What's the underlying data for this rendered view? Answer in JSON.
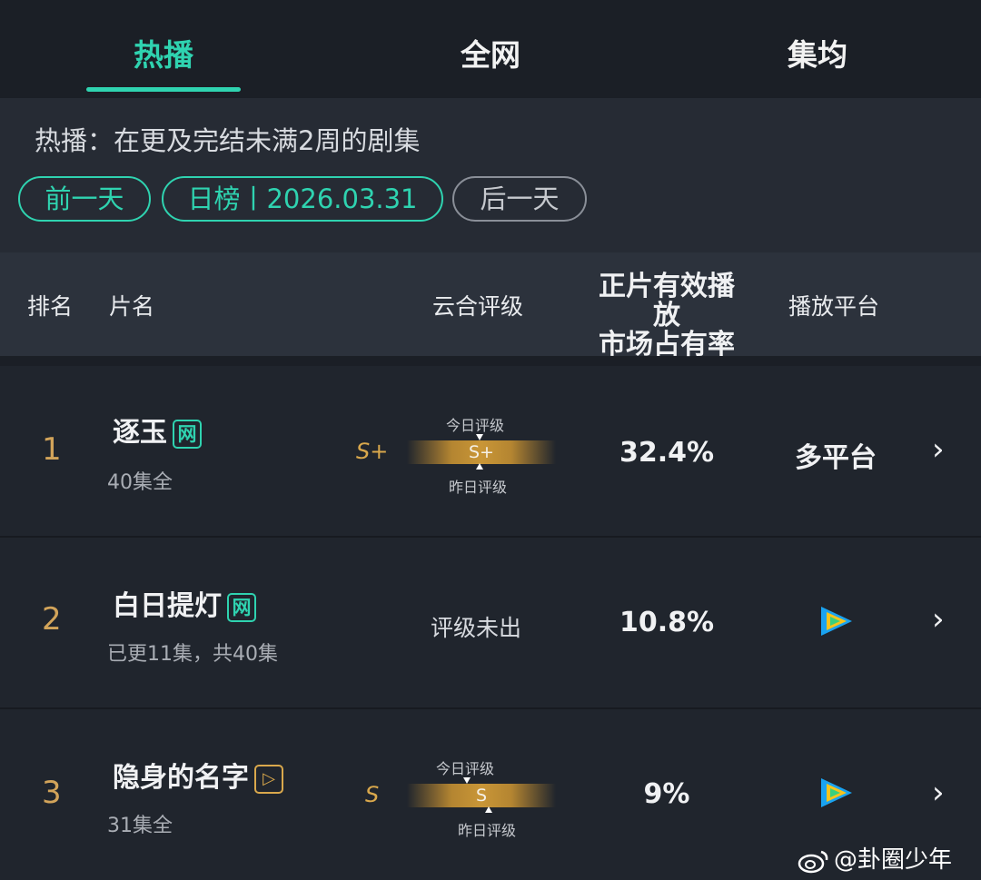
{
  "tabs": [
    {
      "label": "热播",
      "active": true
    },
    {
      "label": "全网",
      "active": false
    },
    {
      "label": "集均",
      "active": false
    }
  ],
  "description": "热播：在更及完结未满2周的剧集",
  "controls": {
    "prev_day": "前一天",
    "date_label": "日榜丨2026.03.31",
    "next_day": "后一天"
  },
  "table": {
    "headers": {
      "rank": "排名",
      "name": "片名",
      "rating": "云合评级",
      "share": "正片有效播放\n市场占有率",
      "platform": "播放平台"
    },
    "rows": [
      {
        "rank": "1",
        "title": "逐玉",
        "badge": "网",
        "episodes": "40集全",
        "grade_left": "S+",
        "grade_bar": "S+",
        "grade_today_label": "今日评级",
        "grade_yesterday_label": "昨日评级",
        "share": "32.4%",
        "platform": "多平台"
      },
      {
        "rank": "2",
        "title": "白日提灯",
        "badge": "网",
        "episodes": "已更11集，共40集",
        "no_grade": "评级未出",
        "share": "10.8%",
        "platform_icon": "tencent-video-icon"
      },
      {
        "rank": "3",
        "title": "隐身的名字",
        "badge": "▷",
        "episodes": "31集全",
        "grade_left": "S",
        "grade_bar": "S",
        "grade_today_label": "今日评级",
        "grade_yesterday_label": "昨日评级",
        "share": "9%",
        "platform_icon": "tencent-video-icon"
      }
    ]
  },
  "chevron": "›",
  "watermark": "@卦圈少年",
  "colors": {
    "accent": "#2fd3b0",
    "gold": "#d9a84c",
    "background": "#1b1f26"
  }
}
